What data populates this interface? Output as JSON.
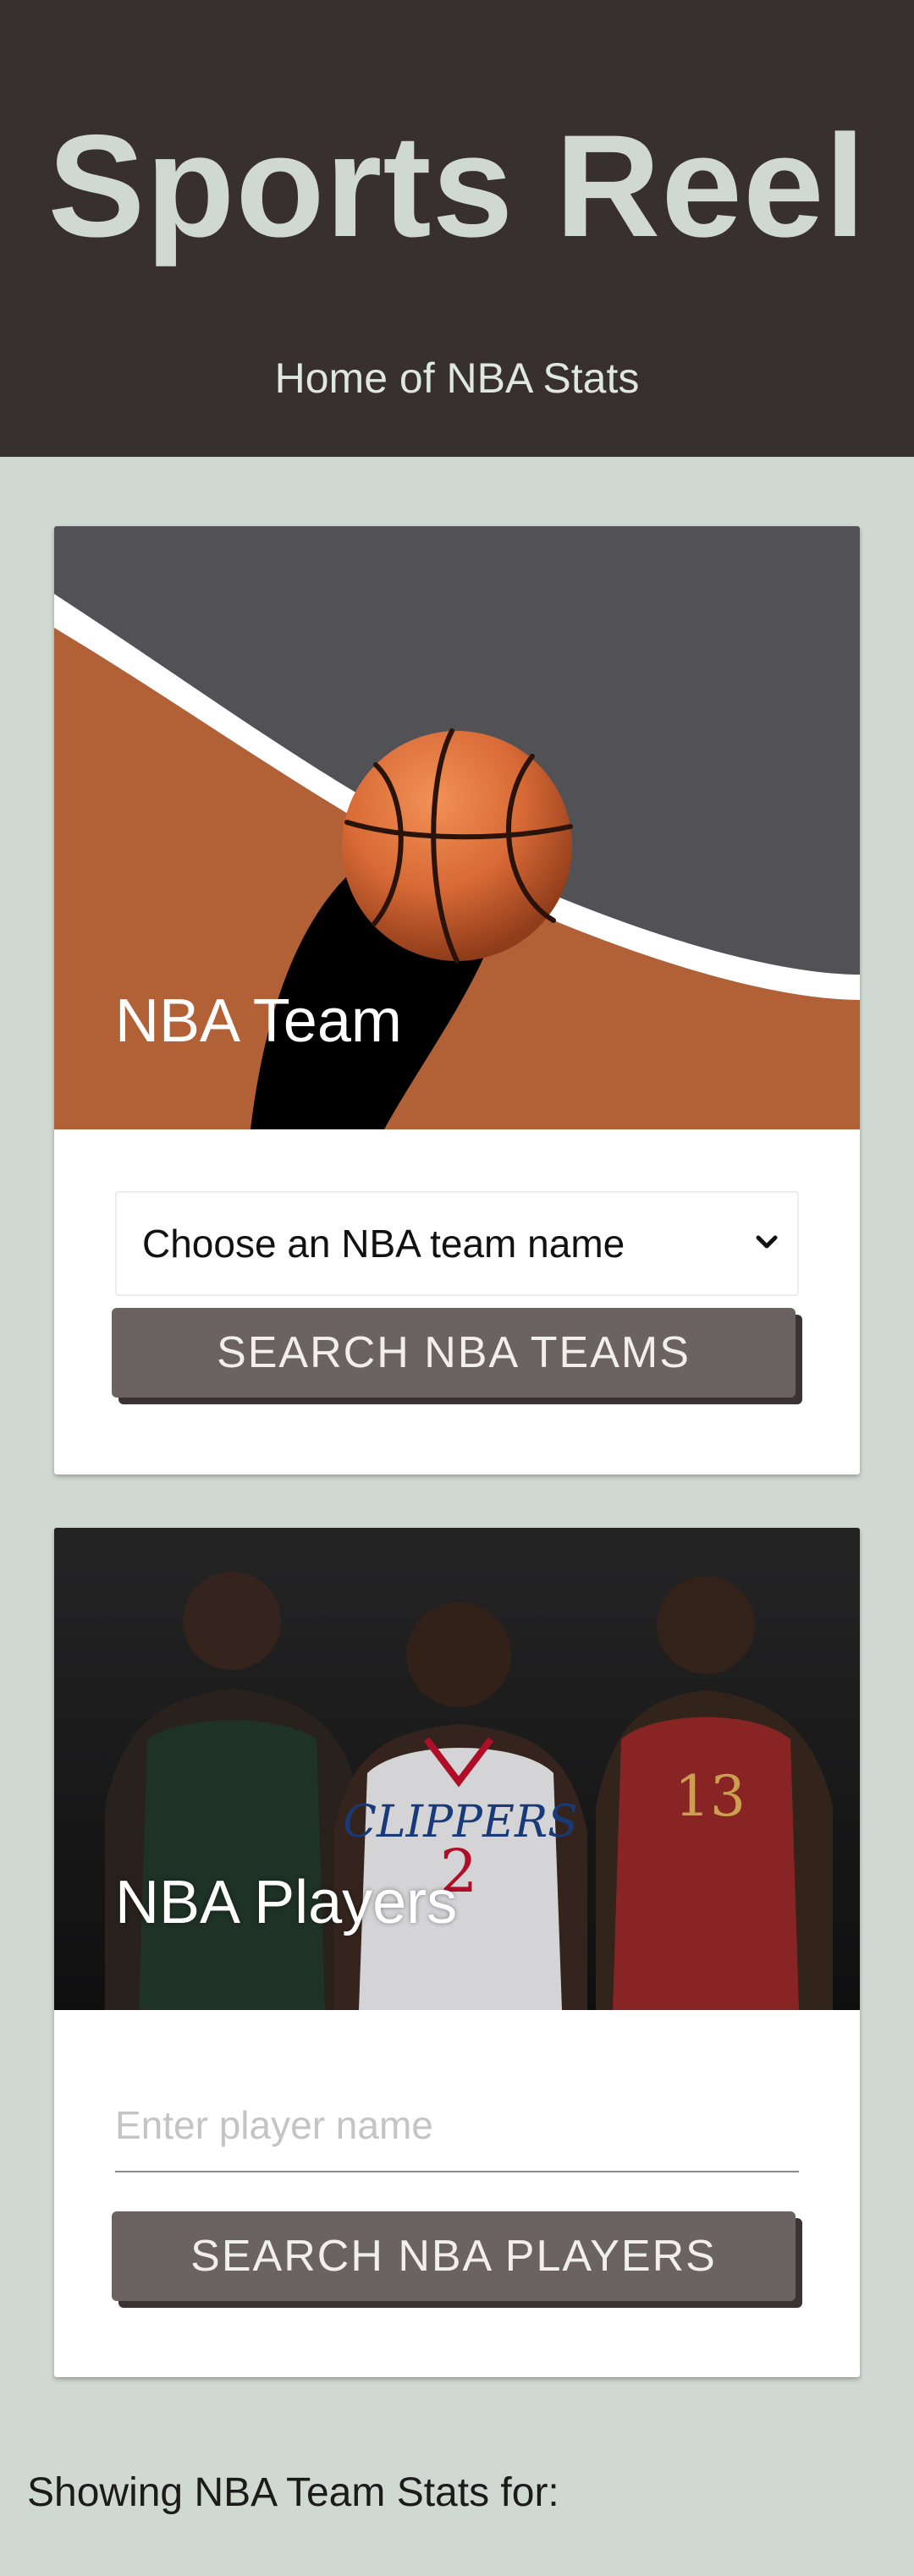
{
  "header": {
    "title": "Sports Reel",
    "subtitle": "Home of NBA Stats"
  },
  "teams_card": {
    "title": "NBA Team",
    "select": {
      "selected": "Choose an NBA team name"
    },
    "search_button": "SEARCH NBA TEAMS"
  },
  "players_card": {
    "title": "NBA Players",
    "input": {
      "placeholder": "Enter player name",
      "value": ""
    },
    "search_button": "SEARCH NBA PLAYERS"
  },
  "footer": {
    "status": "Showing NBA Team Stats for:"
  },
  "colors": {
    "header_bg": "#382f2f",
    "page_bg": "#cfd9d1",
    "button_bg": "#6a6361",
    "court_orange": "#b26136",
    "court_gray": "#515156"
  },
  "icons": {
    "teams_media": "basketball-court-illustration",
    "players_media": "nba-players-photo",
    "select_arrow": "chevron-down-icon"
  }
}
